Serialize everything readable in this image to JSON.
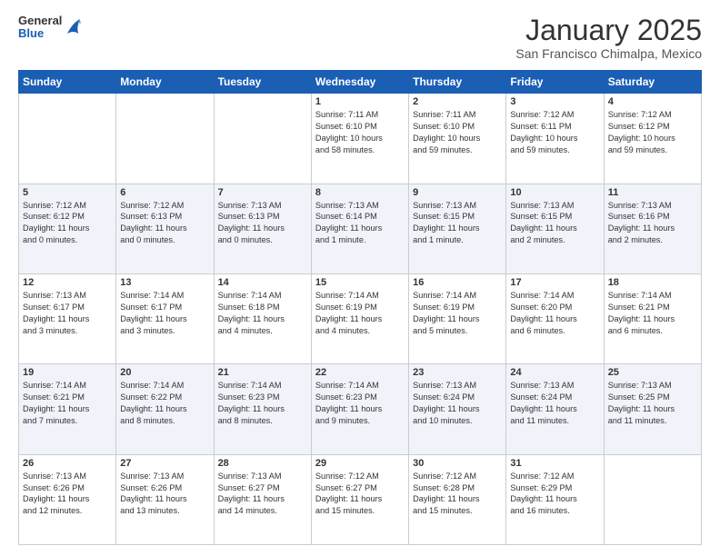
{
  "logo": {
    "general": "General",
    "blue": "Blue"
  },
  "header": {
    "month": "January 2025",
    "location": "San Francisco Chimalpa, Mexico"
  },
  "weekdays": [
    "Sunday",
    "Monday",
    "Tuesday",
    "Wednesday",
    "Thursday",
    "Friday",
    "Saturday"
  ],
  "weeks": [
    [
      {
        "day": "",
        "info": ""
      },
      {
        "day": "",
        "info": ""
      },
      {
        "day": "",
        "info": ""
      },
      {
        "day": "1",
        "info": "Sunrise: 7:11 AM\nSunset: 6:10 PM\nDaylight: 10 hours\nand 58 minutes."
      },
      {
        "day": "2",
        "info": "Sunrise: 7:11 AM\nSunset: 6:10 PM\nDaylight: 10 hours\nand 59 minutes."
      },
      {
        "day": "3",
        "info": "Sunrise: 7:12 AM\nSunset: 6:11 PM\nDaylight: 10 hours\nand 59 minutes."
      },
      {
        "day": "4",
        "info": "Sunrise: 7:12 AM\nSunset: 6:12 PM\nDaylight: 10 hours\nand 59 minutes."
      }
    ],
    [
      {
        "day": "5",
        "info": "Sunrise: 7:12 AM\nSunset: 6:12 PM\nDaylight: 11 hours\nand 0 minutes."
      },
      {
        "day": "6",
        "info": "Sunrise: 7:12 AM\nSunset: 6:13 PM\nDaylight: 11 hours\nand 0 minutes."
      },
      {
        "day": "7",
        "info": "Sunrise: 7:13 AM\nSunset: 6:13 PM\nDaylight: 11 hours\nand 0 minutes."
      },
      {
        "day": "8",
        "info": "Sunrise: 7:13 AM\nSunset: 6:14 PM\nDaylight: 11 hours\nand 1 minute."
      },
      {
        "day": "9",
        "info": "Sunrise: 7:13 AM\nSunset: 6:15 PM\nDaylight: 11 hours\nand 1 minute."
      },
      {
        "day": "10",
        "info": "Sunrise: 7:13 AM\nSunset: 6:15 PM\nDaylight: 11 hours\nand 2 minutes."
      },
      {
        "day": "11",
        "info": "Sunrise: 7:13 AM\nSunset: 6:16 PM\nDaylight: 11 hours\nand 2 minutes."
      }
    ],
    [
      {
        "day": "12",
        "info": "Sunrise: 7:13 AM\nSunset: 6:17 PM\nDaylight: 11 hours\nand 3 minutes."
      },
      {
        "day": "13",
        "info": "Sunrise: 7:14 AM\nSunset: 6:17 PM\nDaylight: 11 hours\nand 3 minutes."
      },
      {
        "day": "14",
        "info": "Sunrise: 7:14 AM\nSunset: 6:18 PM\nDaylight: 11 hours\nand 4 minutes."
      },
      {
        "day": "15",
        "info": "Sunrise: 7:14 AM\nSunset: 6:19 PM\nDaylight: 11 hours\nand 4 minutes."
      },
      {
        "day": "16",
        "info": "Sunrise: 7:14 AM\nSunset: 6:19 PM\nDaylight: 11 hours\nand 5 minutes."
      },
      {
        "day": "17",
        "info": "Sunrise: 7:14 AM\nSunset: 6:20 PM\nDaylight: 11 hours\nand 6 minutes."
      },
      {
        "day": "18",
        "info": "Sunrise: 7:14 AM\nSunset: 6:21 PM\nDaylight: 11 hours\nand 6 minutes."
      }
    ],
    [
      {
        "day": "19",
        "info": "Sunrise: 7:14 AM\nSunset: 6:21 PM\nDaylight: 11 hours\nand 7 minutes."
      },
      {
        "day": "20",
        "info": "Sunrise: 7:14 AM\nSunset: 6:22 PM\nDaylight: 11 hours\nand 8 minutes."
      },
      {
        "day": "21",
        "info": "Sunrise: 7:14 AM\nSunset: 6:23 PM\nDaylight: 11 hours\nand 8 minutes."
      },
      {
        "day": "22",
        "info": "Sunrise: 7:14 AM\nSunset: 6:23 PM\nDaylight: 11 hours\nand 9 minutes."
      },
      {
        "day": "23",
        "info": "Sunrise: 7:13 AM\nSunset: 6:24 PM\nDaylight: 11 hours\nand 10 minutes."
      },
      {
        "day": "24",
        "info": "Sunrise: 7:13 AM\nSunset: 6:24 PM\nDaylight: 11 hours\nand 11 minutes."
      },
      {
        "day": "25",
        "info": "Sunrise: 7:13 AM\nSunset: 6:25 PM\nDaylight: 11 hours\nand 11 minutes."
      }
    ],
    [
      {
        "day": "26",
        "info": "Sunrise: 7:13 AM\nSunset: 6:26 PM\nDaylight: 11 hours\nand 12 minutes."
      },
      {
        "day": "27",
        "info": "Sunrise: 7:13 AM\nSunset: 6:26 PM\nDaylight: 11 hours\nand 13 minutes."
      },
      {
        "day": "28",
        "info": "Sunrise: 7:13 AM\nSunset: 6:27 PM\nDaylight: 11 hours\nand 14 minutes."
      },
      {
        "day": "29",
        "info": "Sunrise: 7:12 AM\nSunset: 6:27 PM\nDaylight: 11 hours\nand 15 minutes."
      },
      {
        "day": "30",
        "info": "Sunrise: 7:12 AM\nSunset: 6:28 PM\nDaylight: 11 hours\nand 15 minutes."
      },
      {
        "day": "31",
        "info": "Sunrise: 7:12 AM\nSunset: 6:29 PM\nDaylight: 11 hours\nand 16 minutes."
      },
      {
        "day": "",
        "info": ""
      }
    ]
  ]
}
